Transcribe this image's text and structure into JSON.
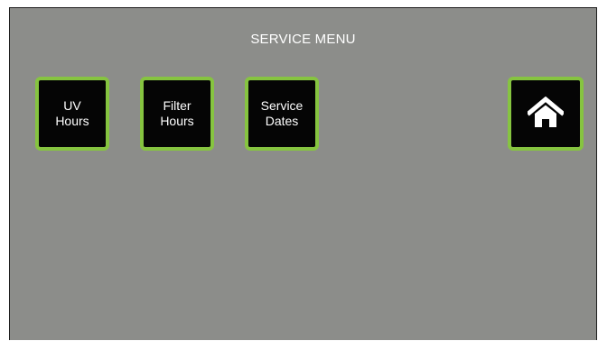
{
  "header": {
    "title": "SERVICE MENU"
  },
  "buttons": {
    "uv_hours": {
      "line1": "UV",
      "line2": "Hours"
    },
    "filter_hours": {
      "line1": "Filter",
      "line2": "Hours"
    },
    "service_dates": {
      "line1": "Service",
      "line2": "Dates"
    },
    "home": {
      "icon": "home-icon"
    }
  },
  "colors": {
    "background": "#8c8d8a",
    "button_fill": "#050505",
    "button_border": "#86c440",
    "text": "#ffffff"
  }
}
